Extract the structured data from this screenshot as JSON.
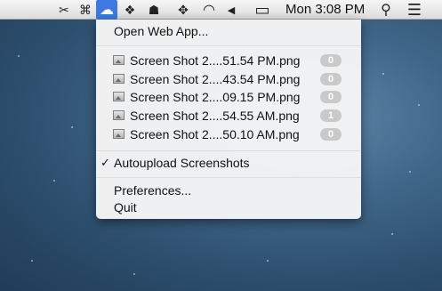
{
  "menubar": {
    "icons": [
      {
        "name": "scissors-icon",
        "glyph": "✂"
      },
      {
        "name": "puzzle-icon",
        "glyph": "⌘"
      },
      {
        "name": "cloud-icon",
        "glyph": "☁"
      },
      {
        "name": "dropbox-icon",
        "glyph": "❖"
      },
      {
        "name": "hat-icon",
        "glyph": "☗"
      },
      {
        "name": "move-icon",
        "glyph": "✥"
      },
      {
        "name": "wifi-icon",
        "glyph": "◠"
      },
      {
        "name": "volume-icon",
        "glyph": "◀"
      },
      {
        "name": "battery-icon",
        "glyph": "▭"
      },
      {
        "name": "search-icon",
        "glyph": "⚲"
      },
      {
        "name": "list-icon",
        "glyph": "☰"
      }
    ],
    "clock": "Mon 3:08 PM",
    "accent": "#3f78e0"
  },
  "menu": {
    "open_web_app": "Open Web App...",
    "files": [
      {
        "label": "Screen Shot 2....51.54 PM.png",
        "count": "0"
      },
      {
        "label": "Screen Shot 2....43.54 PM.png",
        "count": "0"
      },
      {
        "label": "Screen Shot 2....09.15 PM.png",
        "count": "0"
      },
      {
        "label": "Screen Shot 2....54.55 AM.png",
        "count": "1"
      },
      {
        "label": "Screen Shot 2....50.10 AM.png",
        "count": "0"
      }
    ],
    "autoupload_check": "✓",
    "autoupload": "Autoupload Screenshots",
    "preferences": "Preferences...",
    "quit": "Quit"
  }
}
